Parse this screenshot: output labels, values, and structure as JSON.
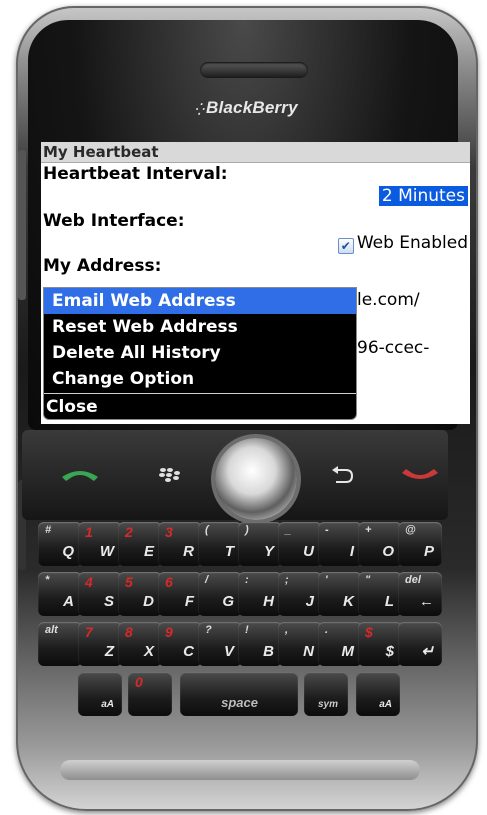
{
  "device": {
    "brand": "BlackBerry",
    "brand_logo_glyph": "⁛"
  },
  "screen": {
    "title": "My Heartbeat",
    "heartbeat_interval_label": "Heartbeat Interval:",
    "heartbeat_interval_value": "2 Minutes",
    "web_interface_label": "Web Interface:",
    "web_enabled_label": "Web Enabled",
    "web_enabled_checked": true,
    "my_address_label": "My Address:",
    "address_line1_partial": "le.com/",
    "address_line2_partial": "96-ccec-"
  },
  "menu": {
    "items": [
      {
        "label": "Email Web Address",
        "selected": true
      },
      {
        "label": "Reset Web Address",
        "selected": false
      },
      {
        "label": "Delete All History",
        "selected": false
      },
      {
        "label": "Change Option",
        "selected": false
      },
      {
        "label": "Close",
        "selected": false
      }
    ]
  },
  "nav": {
    "call_icon": "call-green-icon",
    "menu_icon": "blackberry-menu-icon",
    "back_icon": "back-arrow-icon",
    "end_icon": "end-call-red-icon"
  },
  "keyboard": {
    "row1": [
      {
        "alt": "#",
        "main": "Q"
      },
      {
        "alt": "1",
        "main": "W"
      },
      {
        "alt": "2",
        "main": "E"
      },
      {
        "alt": "3",
        "main": "R"
      },
      {
        "alt": "(",
        "main": "T"
      },
      {
        "alt": ")",
        "main": "Y"
      },
      {
        "alt": "_",
        "main": "U"
      },
      {
        "alt": "-",
        "main": "I"
      },
      {
        "alt": "+",
        "main": "O"
      },
      {
        "alt": "@",
        "main": "P"
      }
    ],
    "row2": [
      {
        "alt": "*",
        "main": "A"
      },
      {
        "alt": "4",
        "main": "S"
      },
      {
        "alt": "5",
        "main": "D"
      },
      {
        "alt": "6",
        "main": "F"
      },
      {
        "alt": "/",
        "main": "G"
      },
      {
        "alt": ":",
        "main": "H"
      },
      {
        "alt": ";",
        "main": "J"
      },
      {
        "alt": "'",
        "main": "K"
      },
      {
        "alt": "\"",
        "main": "L"
      },
      {
        "alt": "del",
        "main": "←"
      }
    ],
    "row3": [
      {
        "alt": "alt",
        "main": ""
      },
      {
        "alt": "7",
        "main": "Z"
      },
      {
        "alt": "8",
        "main": "X"
      },
      {
        "alt": "9",
        "main": "C"
      },
      {
        "alt": "?",
        "main": "V"
      },
      {
        "alt": "!",
        "main": "B"
      },
      {
        "alt": ",",
        "main": "N"
      },
      {
        "alt": ".",
        "main": "M"
      },
      {
        "alt": "$",
        "main": "$"
      },
      {
        "alt": "",
        "main": "↵"
      }
    ],
    "row4": [
      {
        "alt": "",
        "main": "aA"
      },
      {
        "alt": "0",
        "main": ""
      },
      {
        "alt": "",
        "main": "space"
      },
      {
        "alt": "",
        "main": "sym"
      },
      {
        "alt": "",
        "main": "aA"
      }
    ]
  },
  "colors": {
    "highlight": "#2f6ee6",
    "selected_value_bg": "#0a5be0",
    "menu_bg": "#000000",
    "call_green": "#3aa655",
    "end_red": "#c83a3a"
  }
}
